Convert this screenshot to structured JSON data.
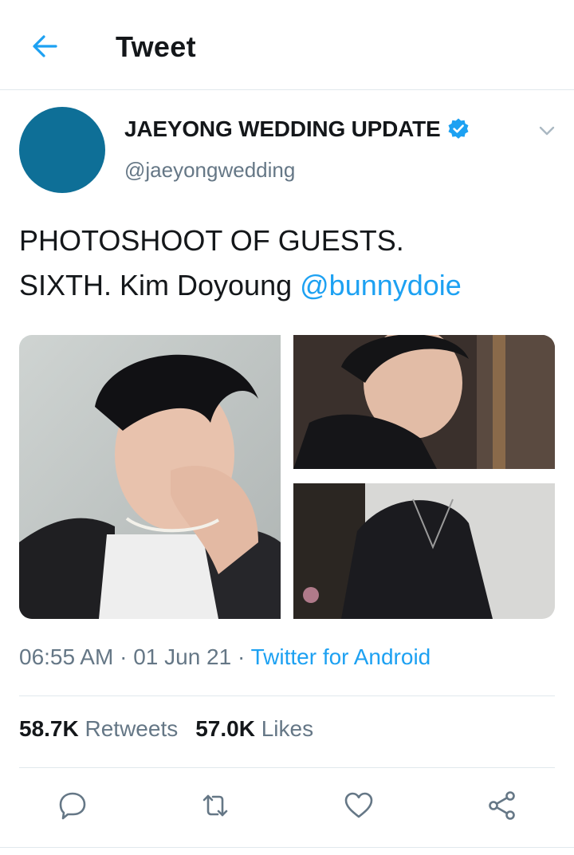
{
  "header": {
    "title": "Tweet",
    "back_icon": "arrow-left-icon",
    "accent": "#1da1f2"
  },
  "author": {
    "display_name": "JAEYONG WEDDING UPDATE",
    "handle": "@jaeyongwedding",
    "verified": true,
    "avatar_color": "#0e6f97"
  },
  "tweet": {
    "line1": "PHOTOSHOOT OF GUESTS.",
    "line2_text": "SIXTH. Kim Doyoung ",
    "mention": "@bunnydoie",
    "images": [
      "photo-1",
      "photo-2",
      "photo-3"
    ]
  },
  "meta": {
    "time": "06:55 AM",
    "sep1": " · ",
    "date": "01 Jun 21",
    "sep2": " · ",
    "source": "Twitter for Android"
  },
  "stats": {
    "retweets_count": "58.7K",
    "retweets_label": "Retweets",
    "likes_count": "57.0K",
    "likes_label": "Likes"
  },
  "actions": [
    "reply-icon",
    "retweet-icon",
    "like-icon",
    "share-icon"
  ]
}
